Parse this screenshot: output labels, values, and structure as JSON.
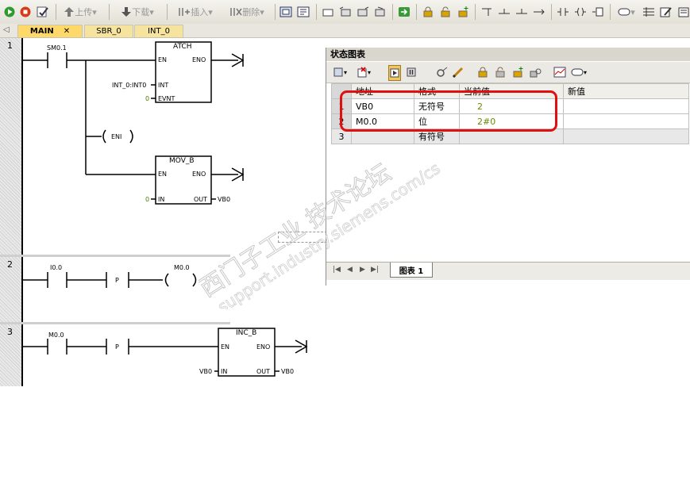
{
  "toolbar": {
    "items": [
      "上传",
      "下载",
      "插入",
      "删除"
    ]
  },
  "tabs": [
    {
      "label": "MAIN"
    },
    {
      "label": "SBR_0"
    },
    {
      "label": "INT_0"
    }
  ],
  "networks": [
    {
      "number": "1",
      "contact": "SM0.1",
      "atch": {
        "title": "ATCH",
        "en": "EN",
        "eno": "ENO",
        "int_pin": "INT",
        "evnt_pin": "EVNT",
        "int_value": "INT_0:INT0",
        "evnt_value": "0"
      },
      "eni": "ENI",
      "mov": {
        "title": "MOV_B",
        "en": "EN",
        "eno": "ENO",
        "in_pin": "IN",
        "out_pin": "OUT",
        "in_value": "0",
        "out_value": "VB0"
      }
    },
    {
      "number": "2",
      "contact": "I0.0",
      "p": "P",
      "coil": "M0.0"
    },
    {
      "number": "3",
      "contact": "M0.0",
      "p": "P",
      "inc": {
        "title": "INC_B",
        "en": "EN",
        "eno": "ENO",
        "in_pin": "IN",
        "out_pin": "OUT",
        "in_value": "VB0",
        "out_value": "VB0"
      }
    }
  ],
  "status_chart": {
    "title": "状态图表",
    "columns": [
      "地址",
      "格式",
      "当前值",
      "新值"
    ],
    "rows": [
      {
        "n": "1",
        "address": "VB0",
        "format": "无符号",
        "current": "2",
        "new": ""
      },
      {
        "n": "2",
        "address": "M0.0",
        "format": "位",
        "current": "2#0",
        "new": ""
      },
      {
        "n": "3",
        "address": "",
        "format": "有符号",
        "current": "",
        "new": ""
      }
    ],
    "sheet_tab": "图表 1"
  },
  "watermark": {
    "line1": "西门子工业  技术论坛",
    "line2": "support.industry.siemens.com/cs"
  },
  "colors": {
    "highlight": "#e01010",
    "active_tab": "#ffd86a",
    "value_text": "#6a8a00"
  }
}
